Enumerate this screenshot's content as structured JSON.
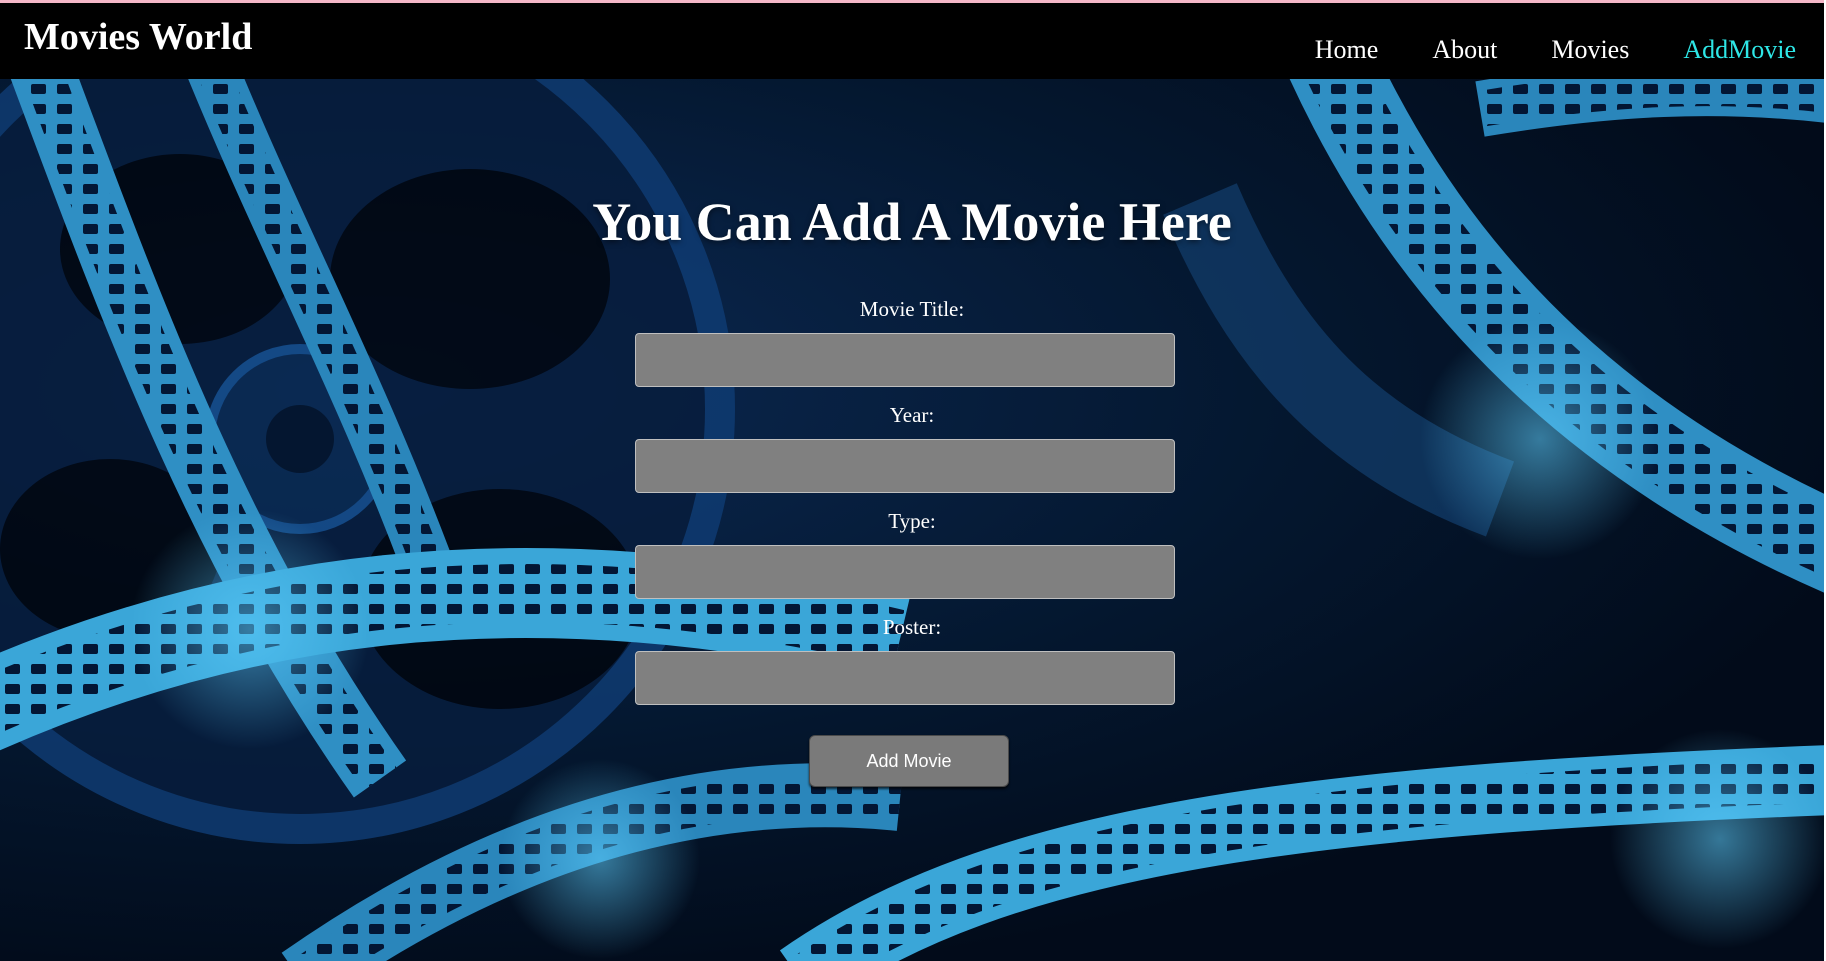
{
  "navbar": {
    "brand": "Movies World",
    "links": [
      {
        "label": "Home",
        "active": false
      },
      {
        "label": "About",
        "active": false
      },
      {
        "label": "Movies",
        "active": false
      },
      {
        "label": "AddMovie",
        "active": true
      }
    ]
  },
  "form": {
    "heading": "You Can Add A Movie Here",
    "fields": [
      {
        "label": "Movie Title:",
        "value": ""
      },
      {
        "label": "Year:",
        "value": ""
      },
      {
        "label": "Type:",
        "value": ""
      },
      {
        "label": "Poster:",
        "value": ""
      }
    ],
    "submit_label": "Add Movie"
  },
  "colors": {
    "navbar_bg": "#000000",
    "active_link": "#2ee6e6",
    "input_bg": "#808080",
    "button_bg": "#7a7a7a",
    "hero_bg": "#031634",
    "film_strip": "#3aa6d8"
  }
}
